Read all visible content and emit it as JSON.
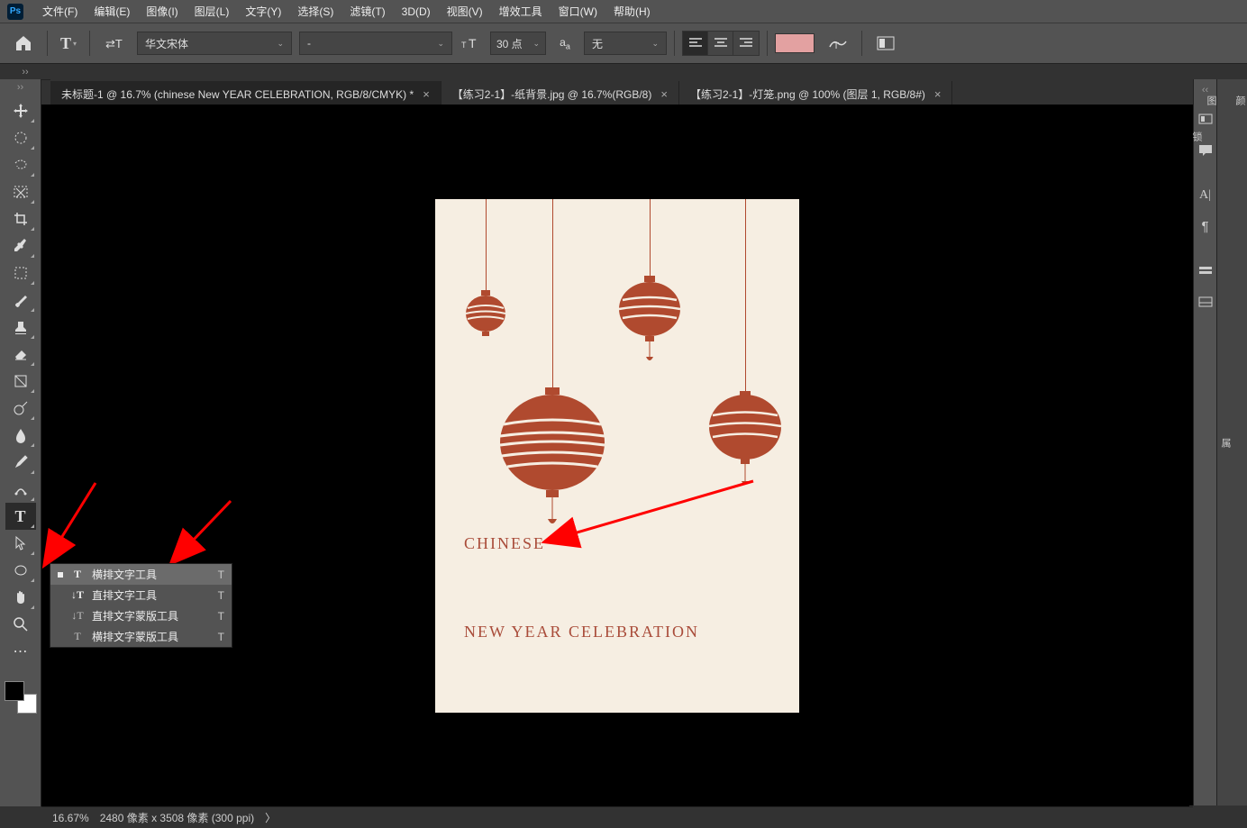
{
  "app": {
    "logo": "Ps"
  },
  "menu": {
    "file": "文件(F)",
    "edit": "编辑(E)",
    "image": "图像(I)",
    "layer": "图层(L)",
    "type": "文字(Y)",
    "select": "选择(S)",
    "filter": "滤镜(T)",
    "threeD": "3D(D)",
    "view": "视图(V)",
    "plugins": "增效工具",
    "window": "窗口(W)",
    "help": "帮助(H)"
  },
  "options": {
    "font_family": "华文宋体",
    "font_style": "-",
    "font_size": "30 点",
    "antialias": "无"
  },
  "tabs": [
    {
      "label": "未标题-1 @ 16.7% (chinese New YEAR CELEBRATION, RGB/8/CMYK) *",
      "active": true
    },
    {
      "label": "【练习2-1】-纸背景.jpg @ 16.7%(RGB/8)",
      "active": false
    },
    {
      "label": "【练习2-1】-灯笼.png @ 100% (图层 1, RGB/8#)",
      "active": false
    }
  ],
  "flyout": {
    "items": [
      {
        "label": "横排文字工具",
        "short": "T",
        "selected": true
      },
      {
        "label": "直排文字工具",
        "short": "T",
        "selected": false
      },
      {
        "label": "直排文字蒙版工具",
        "short": "T",
        "selected": false
      },
      {
        "label": "横排文字蒙版工具",
        "short": "T",
        "selected": false
      }
    ]
  },
  "canvas": {
    "text1": "CHINESE",
    "text2": "NEW YEAR CELEBRATION"
  },
  "status": {
    "zoom": "16.67%",
    "docsize": "2480 像素 x 3508 像素 (300 ppi)",
    "arrow": "〉"
  },
  "colors": {
    "swatch": "#e3a1a1",
    "lantern": "#b04a2f",
    "doc_text": "#a94c3a"
  }
}
